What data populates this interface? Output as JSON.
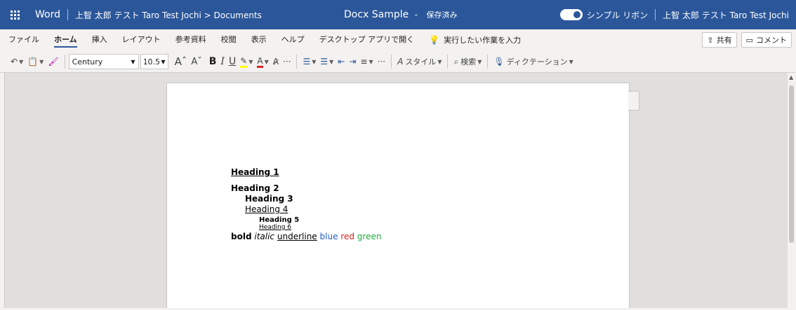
{
  "titlebar": {
    "app_name": "Word",
    "breadcrumb": "上智 太郎 テスト Taro Test Jochi > Documents",
    "doc_title": "Docx Sample",
    "separator": "-",
    "save_state": "保存済み",
    "simple_ribbon_label": "シンプル リボン",
    "user_name": "上智 太郎 テスト Taro Test Jochi",
    "accent_color": "#2b579a"
  },
  "ribbon": {
    "tabs": [
      {
        "label": "ファイル"
      },
      {
        "label": "ホーム",
        "active": true
      },
      {
        "label": "挿入"
      },
      {
        "label": "レイアウト"
      },
      {
        "label": "参考資料"
      },
      {
        "label": "校閲"
      },
      {
        "label": "表示"
      },
      {
        "label": "ヘルプ"
      },
      {
        "label": "デスクトップ アプリで開く"
      }
    ],
    "tell_me": "実行したい作業を入力",
    "share_label": "共有",
    "comment_label": "コメント",
    "font_name": "Century",
    "font_size": "10.5",
    "styles_label": "スタイル",
    "find_label": "検索",
    "dictate_label": "ディクテーション",
    "icons": [
      "undo-icon",
      "paste-icon",
      "format-painter-icon",
      "grow-font-icon",
      "shrink-font-icon",
      "bold-icon",
      "italic-icon",
      "underline-icon",
      "highlight-icon",
      "font-color-icon",
      "clear-format-icon",
      "more-icon",
      "bullets-icon",
      "numbering-icon",
      "decrease-indent-icon",
      "increase-indent-icon",
      "align-icon",
      "styles-icon",
      "search-icon",
      "microphone-icon"
    ]
  },
  "document": {
    "heading1": "Heading 1",
    "heading2": "Heading 2",
    "heading3": "Heading 3",
    "heading4": "Heading 4",
    "heading5": "Heading 5",
    "heading6": "Heading 6",
    "run_bold": "bold",
    "run_italic": "italic",
    "run_underline": "underline",
    "run_blue": "blue",
    "run_red": "red",
    "run_green": "green",
    "colors": {
      "blue": "#1f5fbf",
      "red": "#e02020",
      "green": "#1faa3a"
    }
  }
}
